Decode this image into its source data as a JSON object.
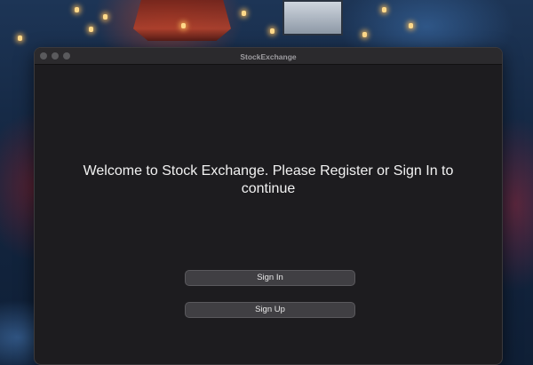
{
  "window": {
    "title": "StockExchange"
  },
  "main": {
    "welcome_message": "Welcome to Stock Exchange. Please Register or Sign In to continue",
    "sign_in_label": "Sign In",
    "sign_up_label": "Sign Up"
  },
  "colors": {
    "window_background": "#1d1c1f",
    "titlebar": "#2b2a2d",
    "button_background": "#403f43",
    "text": "#f2f2f2"
  }
}
